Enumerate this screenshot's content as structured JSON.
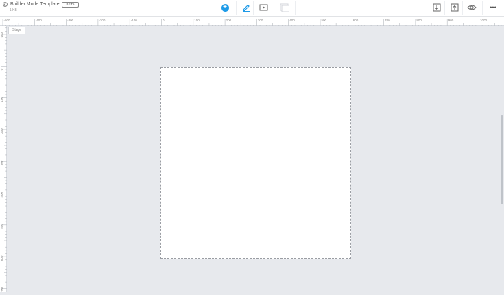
{
  "header": {
    "title": "Builder Mode Template",
    "badge": "BETA",
    "file_size": "1 KB"
  },
  "toolbar": {
    "add": "add-icon",
    "edit": "pencil-icon",
    "preview": "play-icon",
    "gallery": "gallery-icon",
    "download": "download-icon",
    "upload": "upload-icon",
    "view": "eye-icon",
    "more": "•••"
  },
  "rulers": {
    "horizontal_labels": [
      "-500",
      "-400",
      "-300",
      "-200",
      "-100",
      "0",
      "100",
      "200",
      "300",
      "400",
      "500",
      "600",
      "700",
      "800",
      "900",
      "1000"
    ],
    "vertical_labels": [
      "-100",
      "0",
      "100",
      "200",
      "300",
      "400",
      "500",
      "600",
      "700"
    ]
  },
  "stage": {
    "label": "Stage"
  },
  "colors": {
    "accent": "#1e9be8",
    "workspace": "#e7e9ed"
  }
}
